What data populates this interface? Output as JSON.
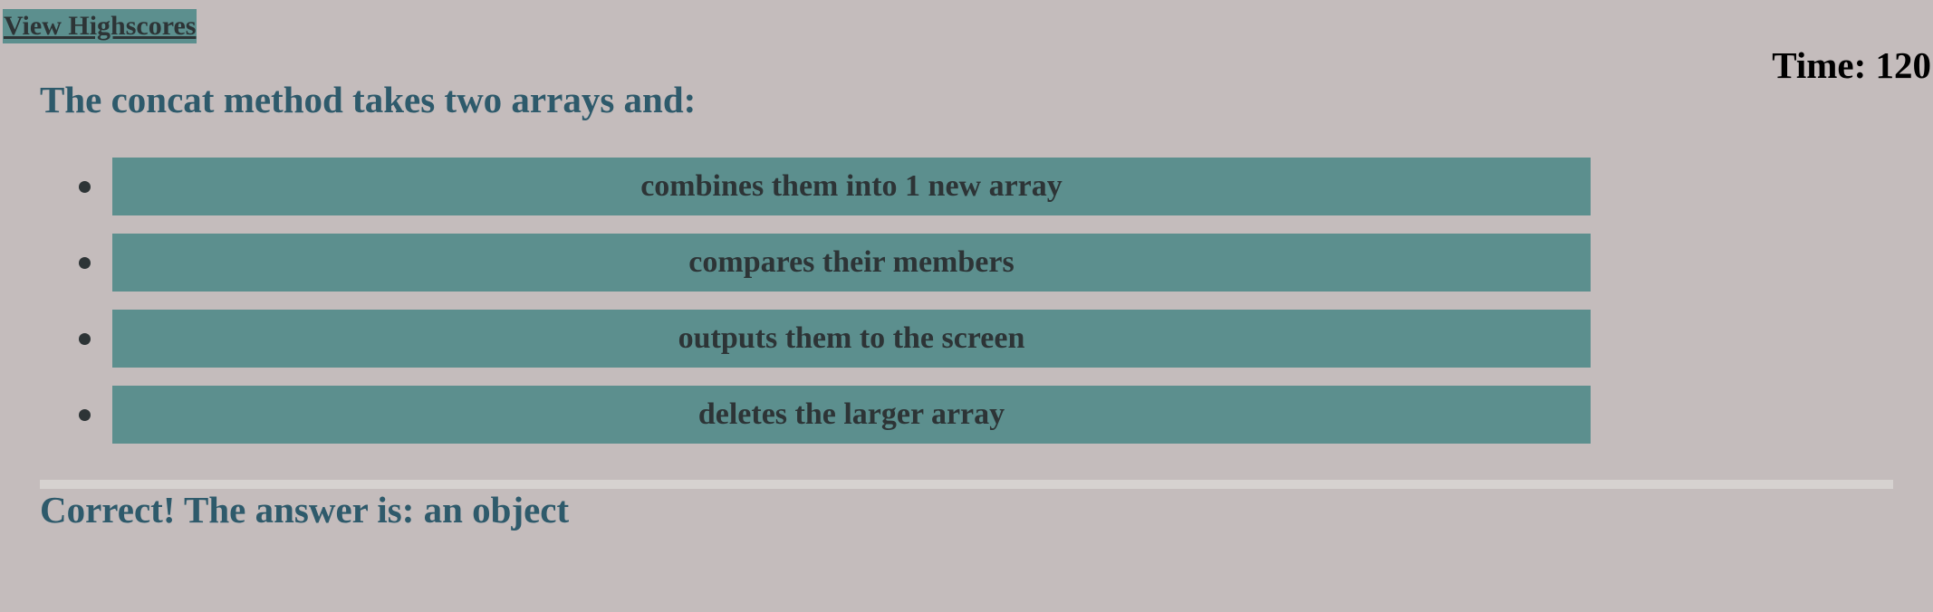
{
  "header": {
    "highscores_link": "View Highscores",
    "timer": "Time: 120"
  },
  "quiz": {
    "question": "The concat method takes two arrays and:",
    "choices": [
      {
        "label": "combines them into 1 new array"
      },
      {
        "label": "compares their members"
      },
      {
        "label": "outputs them to the screen"
      },
      {
        "label": "deletes the larger array"
      }
    ]
  },
  "feedback": {
    "message": "Correct! The answer is: an object"
  },
  "colors": {
    "background": "#c4bcbc",
    "button": "#5c8f8e",
    "heading": "#2e5a6b",
    "text": "#2d3436",
    "divider": "#d6d2d0"
  }
}
